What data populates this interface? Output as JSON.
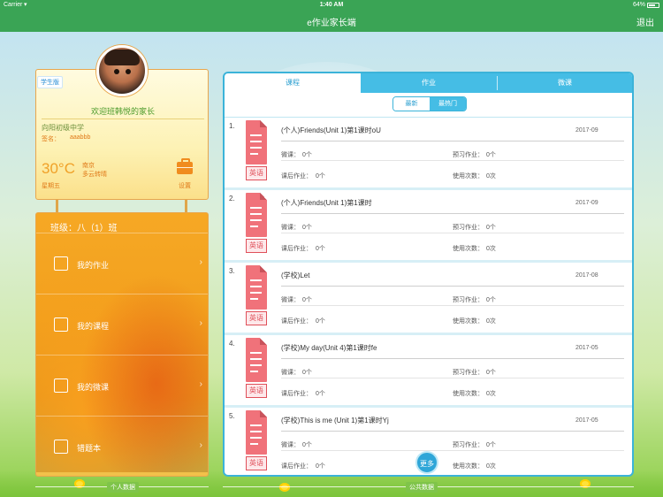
{
  "status_bar": {
    "carrier": "Carrier",
    "time": "1:40 AM",
    "battery": "64%"
  },
  "nav": {
    "title": "e作业家长端",
    "logout": "退出"
  },
  "profile": {
    "role_badge": "学生版",
    "welcome": "欢迎班韩悦的家长",
    "school": "向阳初级中学",
    "signature_label": "签名：",
    "signature_value": "aaabbb",
    "temperature": "30°C",
    "city": "南京",
    "weather": "多云转晴",
    "weekday": "星期五",
    "settings_label": "设置"
  },
  "menu": {
    "class_name": "班级：八（1）班",
    "items": [
      {
        "label": "我的作业",
        "icon": "edit-icon"
      },
      {
        "label": "我的课程",
        "icon": "document-icon"
      },
      {
        "label": "我的微课",
        "icon": "video-icon"
      },
      {
        "label": "错题本",
        "icon": "notebook-icon"
      }
    ]
  },
  "tabs": [
    {
      "label": "课程",
      "active": true
    },
    {
      "label": "作业",
      "active": false
    },
    {
      "label": "微课",
      "active": false
    }
  ],
  "filter": {
    "newest": "最新",
    "hottest": "最热门",
    "selected": "最热门"
  },
  "stat_labels": {
    "micro": "微课：",
    "preview": "预习作业：",
    "after": "课后作业：",
    "usage": "使用次数："
  },
  "courses": [
    {
      "index": "1.",
      "subject": "英语",
      "title": "(个人)Friends(Unit 1)第1课时oU",
      "date": "2017-09",
      "micro": "0个",
      "preview": "0个",
      "after": "0个",
      "usage": "0次"
    },
    {
      "index": "2.",
      "subject": "英语",
      "title": "(个人)Friends(Unit 1)第1课时",
      "date": "2017-09",
      "micro": "0个",
      "preview": "0个",
      "after": "0个",
      "usage": "0次"
    },
    {
      "index": "3.",
      "subject": "英语",
      "title": "(学校)Let",
      "date": "2017-08",
      "micro": "0个",
      "preview": "0个",
      "after": "0个",
      "usage": "0次"
    },
    {
      "index": "4.",
      "subject": "英语",
      "title": "(学校)My day(Unit 4)第1课时fe",
      "date": "2017-05",
      "micro": "0个",
      "preview": "0个",
      "after": "0个",
      "usage": "0次"
    },
    {
      "index": "5.",
      "subject": "英语",
      "title": "(学校)This is me (Unit 1)第1课时Yj",
      "date": "2017-05",
      "micro": "0个",
      "preview": "0个",
      "after": "0个",
      "usage": "0次"
    }
  ],
  "more_button": "更多",
  "bottom": {
    "personal": "个人数据",
    "public": "公共数据"
  },
  "colors": {
    "nav_green": "#3aa455",
    "accent_blue": "#45bde5",
    "subject_red": "#f0727a",
    "menu_orange": "#f2a01d"
  }
}
